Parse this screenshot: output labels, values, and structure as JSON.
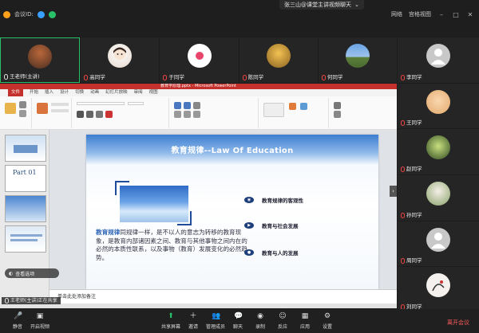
{
  "window": {
    "title": "张三山@课堂主讲视频聊天",
    "left_status": "会议ID: ",
    "network": "网络",
    "layout_label": "宫格视图"
  },
  "participants_strip": [
    {
      "name": "王老师(主讲)",
      "active": true,
      "avatar_color": "#7a4b32",
      "muted": false
    },
    {
      "name": "高同学",
      "active": false,
      "avatar_color": "#f1e8df",
      "muted": true
    },
    {
      "name": "于同学",
      "active": false,
      "avatar_color": "#ffffff",
      "muted": true
    },
    {
      "name": "陈同学",
      "active": false,
      "avatar_color": "#c9902e",
      "muted": true
    },
    {
      "name": "何同学",
      "active": false,
      "avatar_color": "#5d8fcf",
      "muted": true
    }
  ],
  "participants_side": [
    {
      "name": "李同学",
      "avatar_color": "#bdbdbd"
    },
    {
      "name": "王同学",
      "avatar_color": "#f2c390"
    },
    {
      "name": "赵同学",
      "avatar_color": "#9fbf6a"
    },
    {
      "name": "孙同学",
      "avatar_color": "#cfd9c2"
    },
    {
      "name": "周同学",
      "avatar_color": "#bdbdbd"
    },
    {
      "name": "刘同学",
      "avatar_color": "#e9e4e0"
    }
  ],
  "ppt": {
    "app_title": "教育学原理.pptx - Microsoft PowerPoint",
    "tabs": [
      "文件",
      "开始",
      "插入",
      "设计",
      "切换",
      "动画",
      "幻灯片放映",
      "审阅",
      "视图"
    ],
    "thumb_label": "Part 01",
    "thumb_numbers": [
      "1",
      "2",
      "3",
      "4"
    ],
    "notes": "单击此处添加备注"
  },
  "slide": {
    "title": "教育规律--Law Of Education",
    "body_highlight": "教育规律",
    "body_rest": "同规律一样，是不以人的意志为转移的教育现象，是教育内部诸因素之间、教育与其他事物之间内在的必然的本质性联系，以及事物（教育）发展变化的必然趋势。",
    "points": [
      "教育规律的客观性",
      "教育与社会发展",
      "教育与人的发展"
    ]
  },
  "share_tag": "王老师(主讲)正在共享",
  "view_pill": "查看选项",
  "toolbar": {
    "left": [
      "静音",
      "开启视频"
    ],
    "center": [
      "共享屏幕",
      "邀请",
      "管理成员",
      "聊天",
      "录制",
      "反应",
      "应用",
      "设置"
    ],
    "leave": "离开会议"
  },
  "colors": {
    "active_border": "#29c06a",
    "ppt_red": "#c4302b",
    "slide_blue": "#3c7ed0",
    "leave_red": "#ff5b5b"
  }
}
